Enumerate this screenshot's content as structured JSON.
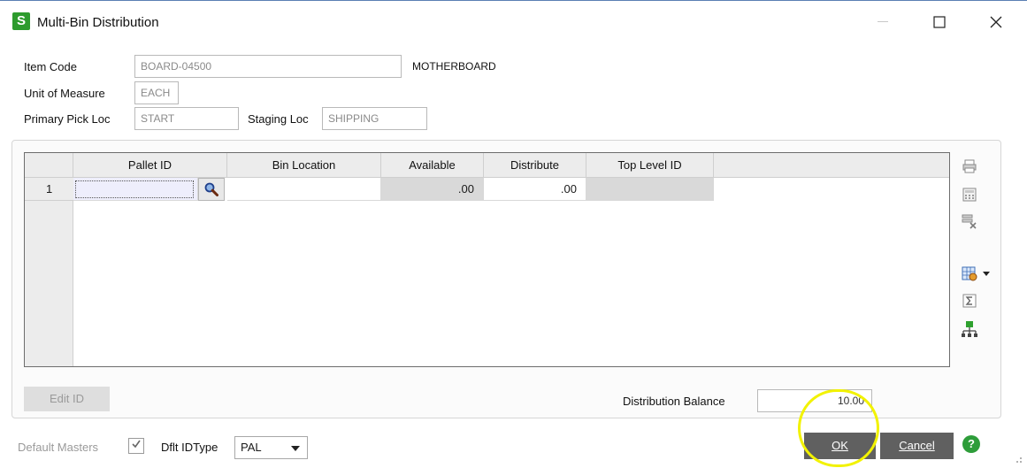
{
  "window": {
    "app_icon_letter": "S",
    "title": "Multi-Bin Distribution"
  },
  "header": {
    "item_code_label": "Item Code",
    "item_code_value": "BOARD-04500",
    "item_description": "MOTHERBOARD",
    "uom_label": "Unit of Measure",
    "uom_value": "EACH",
    "primary_pick_label": "Primary Pick Loc",
    "primary_pick_value": "START",
    "staging_label": "Staging Loc",
    "staging_value": "SHIPPING"
  },
  "grid": {
    "columns": [
      "Pallet ID",
      "Bin Location",
      "Available",
      "Distribute",
      "Top Level ID"
    ],
    "rows": [
      {
        "num": "1",
        "pallet_id": "",
        "bin_location": "",
        "available": ".00",
        "distribute": ".00",
        "top_level_id": ""
      }
    ]
  },
  "toolbar_icons": [
    "print-icon",
    "calculator-icon",
    "delete-rows-icon",
    "grid-settings-icon",
    "sum-icon",
    "hierarchy-icon"
  ],
  "footer": {
    "edit_id_label": "Edit ID",
    "distribution_balance_label": "Distribution Balance",
    "distribution_balance_value": "10.00",
    "default_masters_label": "Default Masters",
    "default_masters_checked": true,
    "dflt_id_type_label": "Dflt IDType",
    "dflt_id_type_value": "PAL",
    "ok_label": "OK",
    "cancel_label": "Cancel",
    "help_symbol": "?"
  },
  "colors": {
    "app_icon": "#2d9b2d",
    "button_dark": "#606060",
    "highlight": "#f2f200",
    "help": "#2e9d3a"
  }
}
